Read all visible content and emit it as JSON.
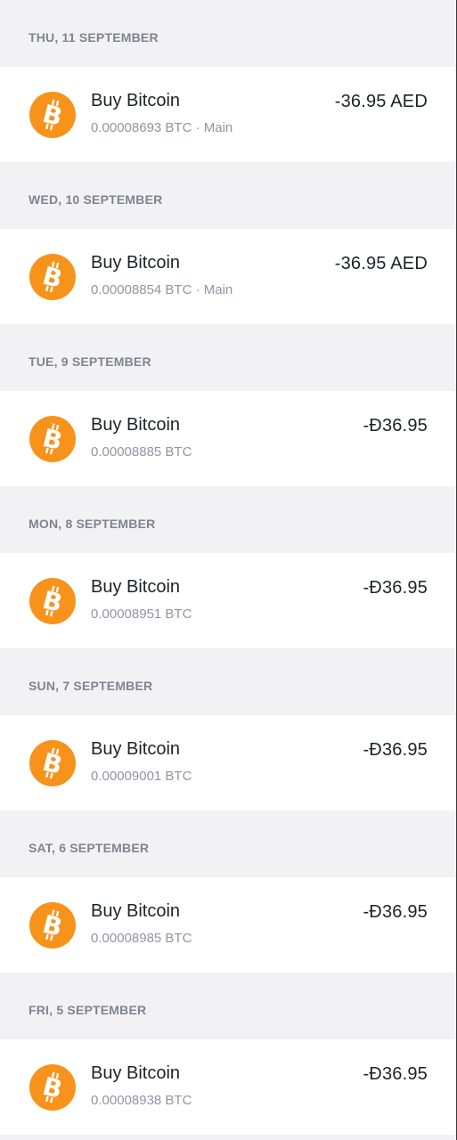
{
  "colors": {
    "bitcoin_orange": "#f7931a",
    "background": "#f2f2f4",
    "text_primary": "#1e2228",
    "text_secondary": "#8f96a1"
  },
  "groups": [
    {
      "date": "THU, 11 SEPTEMBER",
      "icon": "bitcoin-icon",
      "title": "Buy Bitcoin",
      "subtitle": "0.00008693 BTC · Main",
      "amount": "-36.95 AED"
    },
    {
      "date": "WED, 10 SEPTEMBER",
      "icon": "bitcoin-icon",
      "title": "Buy Bitcoin",
      "subtitle": "0.00008854 BTC · Main",
      "amount": "-36.95 AED"
    },
    {
      "date": "TUE, 9 SEPTEMBER",
      "icon": "bitcoin-icon",
      "title": "Buy Bitcoin",
      "subtitle": "0.00008885 BTC",
      "amount": "-Ð36.95"
    },
    {
      "date": "MON, 8 SEPTEMBER",
      "icon": "bitcoin-icon",
      "title": "Buy Bitcoin",
      "subtitle": "0.00008951 BTC",
      "amount": "-Ð36.95"
    },
    {
      "date": "SUN, 7 SEPTEMBER",
      "icon": "bitcoin-icon",
      "title": "Buy Bitcoin",
      "subtitle": "0.00009001 BTC",
      "amount": "-Ð36.95"
    },
    {
      "date": "SAT, 6 SEPTEMBER",
      "icon": "bitcoin-icon",
      "title": "Buy Bitcoin",
      "subtitle": "0.00008985 BTC",
      "amount": "-Ð36.95"
    },
    {
      "date": "FRI, 5 SEPTEMBER",
      "icon": "bitcoin-icon",
      "title": "Buy Bitcoin",
      "subtitle": "0.00008938 BTC",
      "amount": "-Ð36.95"
    }
  ]
}
